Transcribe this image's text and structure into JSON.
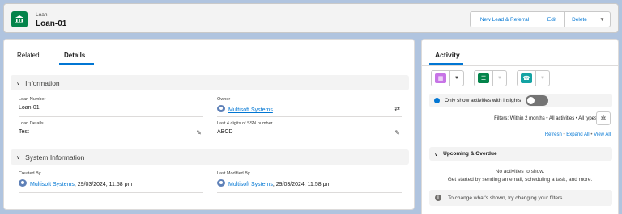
{
  "header": {
    "object_type": "Loan",
    "record_name": "Loan-01",
    "buttons": {
      "new_lead": "New Lead & Referral",
      "edit": "Edit",
      "delete": "Delete"
    }
  },
  "tabs": {
    "related": "Related",
    "details": "Details"
  },
  "sections": {
    "information": "Information",
    "system_information": "System Information"
  },
  "fields": {
    "loan_number": {
      "label": "Loan Number",
      "value": "Loan-01"
    },
    "owner": {
      "label": "Owner",
      "value": "Multisoft Systems"
    },
    "loan_details": {
      "label": "Loan Details",
      "value": "Test"
    },
    "ssn_last4": {
      "label": "Last 4 digits of SSN number",
      "value": "ABCD"
    },
    "created_by": {
      "label": "Created By",
      "user": "Multisoft Systems",
      "date": ", 29/03/2024, 11:58 pm"
    },
    "last_modified_by": {
      "label": "Last Modified By",
      "user": "Multisoft Systems",
      "date": ", 29/03/2024, 11:58 pm"
    }
  },
  "activity": {
    "title": "Activity",
    "insights_toggle_label": "Only show activities with insights",
    "filters_text": "Filters: Within 2 months • All activities • All types",
    "links": {
      "refresh": "Refresh",
      "expand_all": "Expand All",
      "view_all": "View All"
    },
    "upcoming_label": "Upcoming & Overdue",
    "no_activities": "No activities to show.",
    "get_started": "Get started by sending an email, scheduling a task, and more.",
    "filter_hint": "To change what's shown, try changing your filters."
  },
  "icons": {
    "loan": "bank-icon",
    "event": "calendar-icon",
    "task": "task-list-icon",
    "call": "phone-icon",
    "user": "user-avatar-icon",
    "edit": "pencil-icon",
    "change_owner": "change-owner-icon",
    "settings": "gear-icon",
    "info": "info-icon"
  },
  "colors": {
    "loan_icon": "#04844b",
    "event_icon": "#c774e6",
    "task_icon": "#04844b",
    "call_icon": "#14a3a3",
    "link": "#0176d3",
    "page_bg": "#b0c4df"
  }
}
